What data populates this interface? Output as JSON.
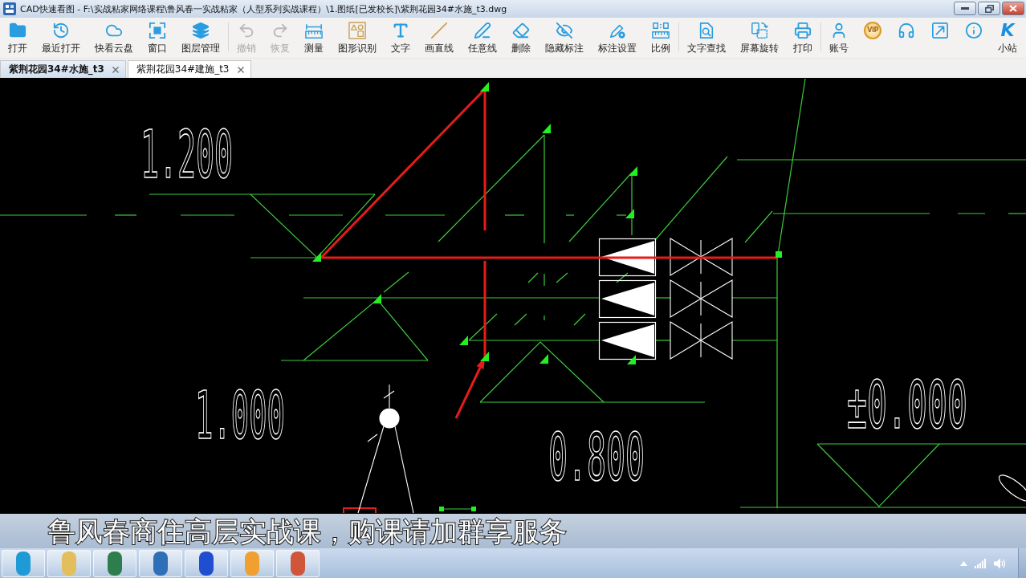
{
  "window": {
    "title": "CAD快速看图 - F:\\实战粘家网络课程\\鲁风春一实战粘家（人型系列实战课程）\\1.图纸[已发校长]\\紫荆花园34#水施_t3.dwg"
  },
  "toolbar": {
    "groups": [
      [
        {
          "label": "打开",
          "disabled": false
        },
        {
          "label": "最近打开",
          "disabled": false
        },
        {
          "label": "快看云盘",
          "disabled": false
        },
        {
          "label": "窗口",
          "disabled": false
        },
        {
          "label": "图层管理",
          "disabled": false
        }
      ],
      [
        {
          "label": "撤销",
          "disabled": true
        },
        {
          "label": "恢复",
          "disabled": true
        },
        {
          "label": "测量",
          "disabled": false
        },
        {
          "label": "图形识别",
          "disabled": false
        },
        {
          "label": "文字",
          "disabled": false
        },
        {
          "label": "画直线",
          "disabled": false
        },
        {
          "label": "任意线",
          "disabled": false
        },
        {
          "label": "删除",
          "disabled": false
        },
        {
          "label": "隐藏标注",
          "disabled": false
        },
        {
          "label": "标注设置",
          "disabled": false
        },
        {
          "label": "比例",
          "disabled": false
        }
      ],
      [
        {
          "label": "文字查找",
          "disabled": false
        },
        {
          "label": "屏幕旋转",
          "disabled": false
        },
        {
          "label": "打印",
          "disabled": false
        }
      ],
      [
        {
          "label": "账号",
          "disabled": false
        },
        {
          "badge": "VIP",
          "disabled": false
        },
        {
          "disabled": false
        },
        {
          "disabled": false
        },
        {
          "disabled": false
        },
        {
          "label": "小站",
          "logo": "K",
          "disabled": false
        }
      ]
    ]
  },
  "tabs": [
    {
      "label": "紫荆花园34#水施_t3",
      "selected": true
    },
    {
      "label": "紫荆花园34#建施_t3",
      "selected": false
    }
  ],
  "drawing": {
    "elevations": [
      "1.200",
      "1.000",
      "0.800",
      "±0.000"
    ]
  },
  "caption": "鲁风春商住高层实战课，购课请加群享服务",
  "taskbar": {
    "apps": [
      {
        "color": "#1e9ad6"
      },
      {
        "color": "#e2bf5c"
      },
      {
        "color": "#2e7d4f"
      },
      {
        "color": "#2f6fb8"
      },
      {
        "color": "#1f4fd0"
      },
      {
        "color": "#f0a030"
      },
      {
        "color": "#d0553a"
      }
    ]
  }
}
